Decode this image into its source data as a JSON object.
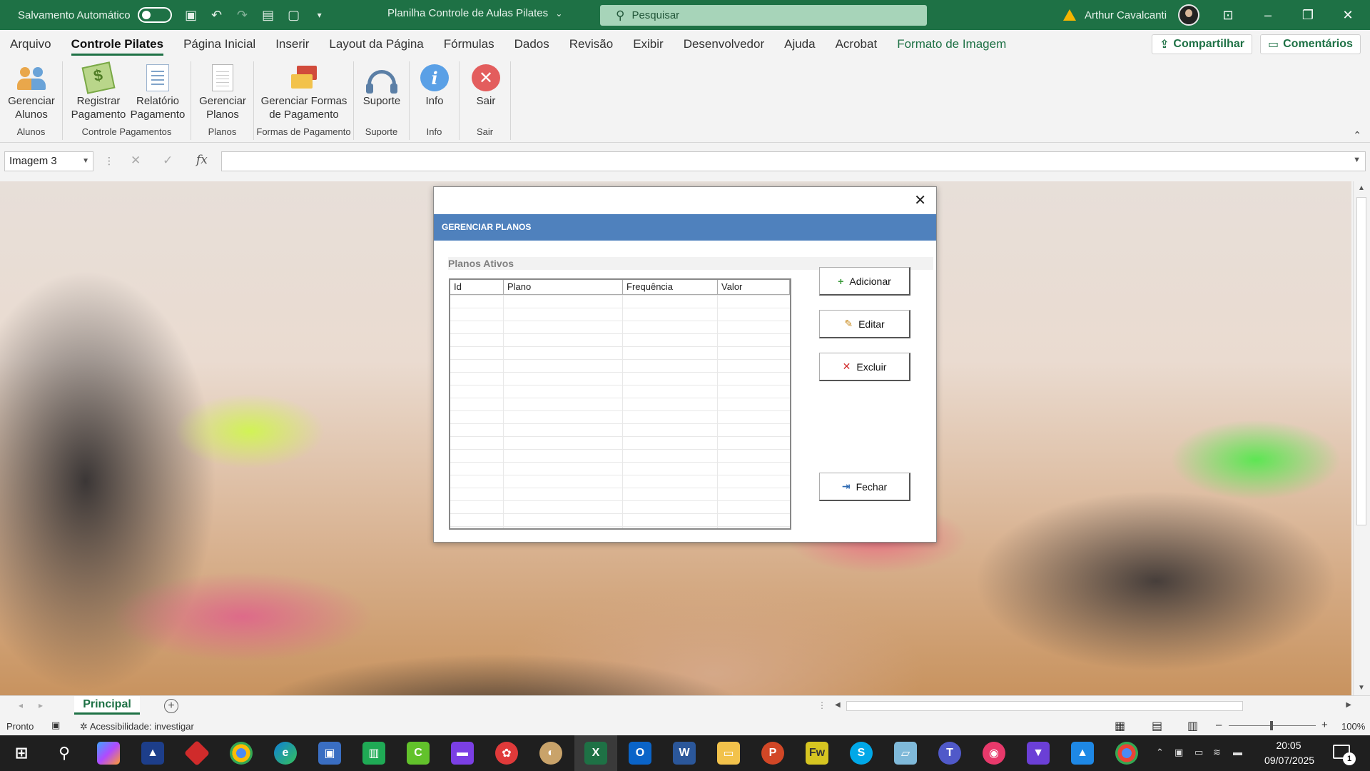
{
  "titlebar": {
    "autosave_label": "Salvamento Automático",
    "doc_title": "Planilha Controle de Aulas Pilates",
    "doc_title_caret": "⌄",
    "search_placeholder": "Pesquisar",
    "user_name": "Arthur Cavalcanti"
  },
  "tabs": [
    {
      "label": "Arquivo"
    },
    {
      "label": "Controle Pilates"
    },
    {
      "label": "Página Inicial"
    },
    {
      "label": "Inserir"
    },
    {
      "label": "Layout da Página"
    },
    {
      "label": "Fórmulas"
    },
    {
      "label": "Dados"
    },
    {
      "label": "Revisão"
    },
    {
      "label": "Exibir"
    },
    {
      "label": "Desenvolvedor"
    },
    {
      "label": "Ajuda"
    },
    {
      "label": "Acrobat"
    },
    {
      "label": "Formato de Imagem"
    }
  ],
  "share": {
    "share_label": "Compartilhar",
    "comments_label": "Comentários"
  },
  "ribbon": {
    "groups": [
      {
        "label": "Alunos"
      },
      {
        "label": "Controle Pagamentos"
      },
      {
        "label": "Planos"
      },
      {
        "label": "Formas de Pagamento"
      },
      {
        "label": "Suporte"
      },
      {
        "label": "Info"
      },
      {
        "label": "Sair"
      }
    ],
    "buttons": {
      "gerenciar_alunos": [
        "Gerenciar",
        "Alunos"
      ],
      "registrar_pagamento": [
        "Registrar",
        "Pagamento"
      ],
      "relatorio_pagamento": [
        "Relatório",
        "Pagamento"
      ],
      "gerenciar_planos": [
        "Gerenciar",
        "Planos"
      ],
      "gerenciar_formas": [
        "Gerenciar Formas",
        "de Pagamento"
      ],
      "suporte": [
        "Suporte"
      ],
      "info": [
        "Info"
      ],
      "sair": [
        "Sair"
      ]
    },
    "info_glyph": "i",
    "exit_glyph": "✕"
  },
  "formula_bar": {
    "name_box": "Imagem 3",
    "formula": ""
  },
  "dialog": {
    "title": "GERENCIAR PLANOS",
    "section_label": "Planos Ativos",
    "columns": [
      "Id",
      "Plano",
      "Frequência",
      "Valor"
    ],
    "buttons": {
      "add": "Adicionar",
      "edit": "Editar",
      "delete": "Excluir",
      "close": "Fechar"
    }
  },
  "sheet_tabs": {
    "active": "Principal"
  },
  "statusbar": {
    "ready": "Pronto",
    "accessibility": "Acessibilidade: investigar",
    "zoom": "100%"
  },
  "taskbar": {
    "time": "20:05",
    "date": "09/07/2025",
    "notifications": "1"
  },
  "colors": {
    "excel_green": "#1e7145",
    "dialog_header": "#4f81bd"
  }
}
